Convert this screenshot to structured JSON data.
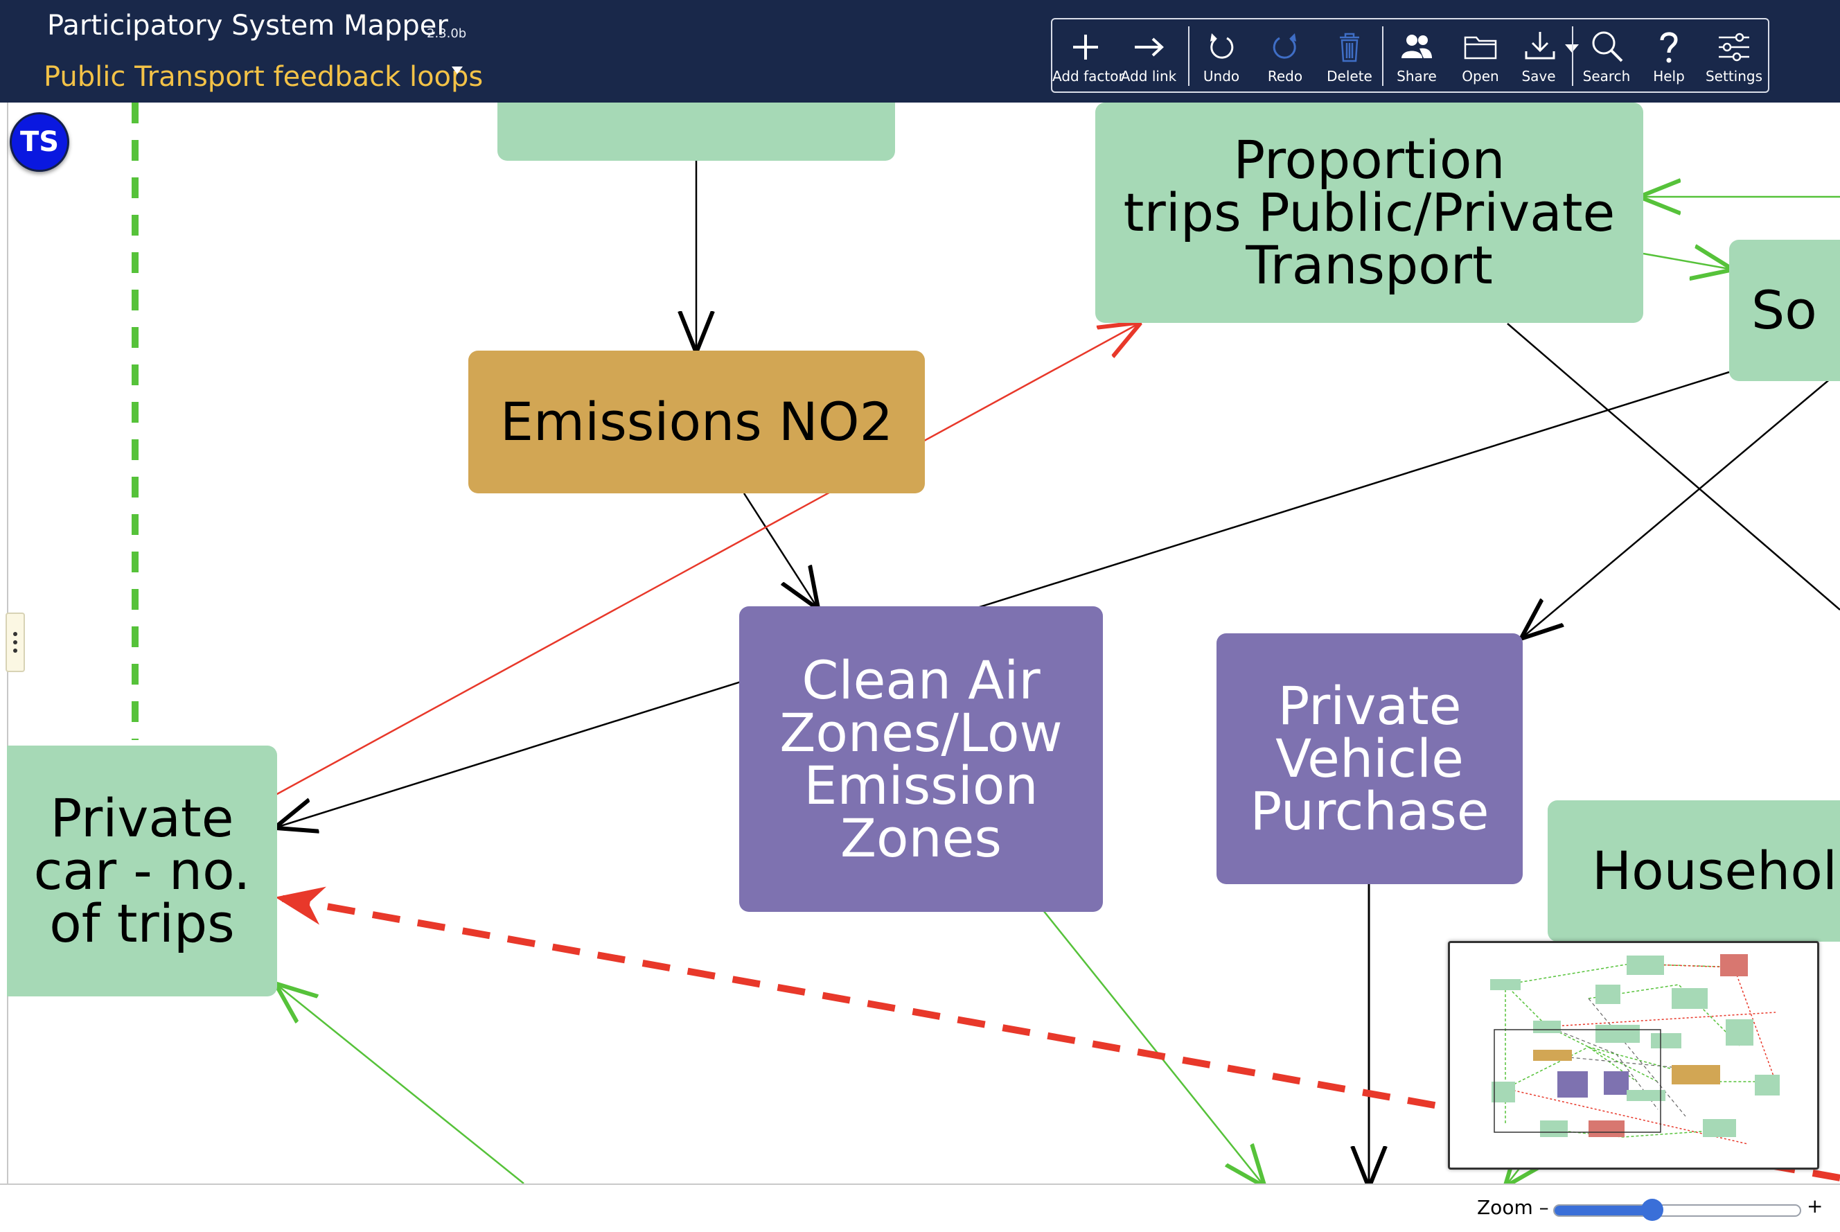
{
  "header": {
    "app_title": "Participatory System Mapper",
    "version": "2.3.0b",
    "map_title": "Public Transport feedback loops"
  },
  "toolbar": {
    "add_factor": "Add factor",
    "add_link": "Add link",
    "undo": "Undo",
    "redo": "Redo",
    "delete": "Delete",
    "share": "Share",
    "open": "Open",
    "save": "Save",
    "search": "Search",
    "help": "Help",
    "settings": "Settings"
  },
  "user": {
    "initials": "TS"
  },
  "nodes": {
    "emissions": "Emissions NO2",
    "proportion": [
      "Proportion",
      "trips Public/Private",
      "Transport"
    ],
    "clean_air": [
      "Clean Air",
      "Zones/Low",
      "Emission",
      "Zones"
    ],
    "private_vehicle": [
      "Private",
      "Vehicle",
      "Purchase"
    ],
    "private_car": [
      "Private",
      "car - no.",
      "of trips"
    ],
    "household": "Househol",
    "so": "So"
  },
  "colors": {
    "factor_green": "#a6d9b6",
    "factor_gold": "#d2a654",
    "factor_purple": "#7e72b0",
    "link_positive": "#56c23a",
    "link_negative": "#e8382a",
    "link_neutral": "#000000",
    "navbar": "#19284a",
    "map_title": "#f3c247"
  },
  "icons": {
    "add_factor": "plus-icon",
    "add_link": "arrow-right-icon",
    "undo": "undo-icon",
    "redo": "redo-icon",
    "delete": "trash-icon",
    "share": "users-icon",
    "open": "folder-icon",
    "save": "download-icon",
    "search": "search-icon",
    "help": "question-icon",
    "settings": "sliders-icon"
  },
  "footer": {
    "zoom_label": "Zoom –",
    "zoom_plus": "+",
    "zoom_level": 0.4
  }
}
